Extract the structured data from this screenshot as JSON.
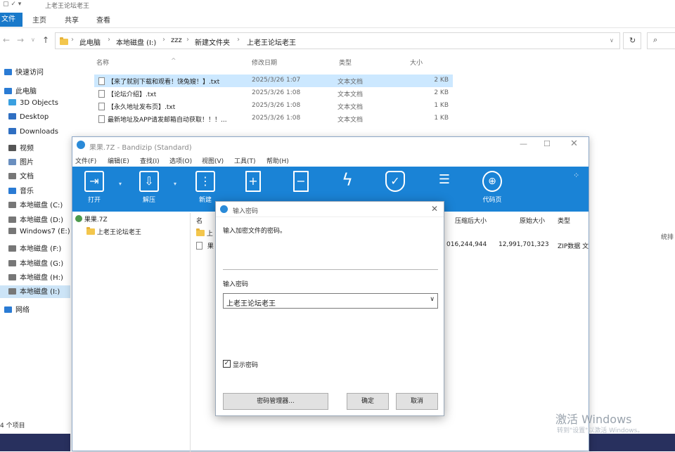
{
  "explorer": {
    "title": "上老王论坛老王",
    "ribbon_tabs": [
      "文件",
      "主页",
      "共享",
      "查看"
    ],
    "breadcrumbs": [
      "此电脑",
      "本地磁盘 (I:)",
      "zzz",
      "新建文件夹",
      "上老王论坛老王"
    ],
    "sidebar": [
      {
        "label": "快速访问",
        "icon": "star-icon",
        "color": "#2a7bd4"
      },
      {
        "label": "此电脑",
        "icon": "computer-icon",
        "color": "#2a7bd4"
      },
      {
        "label": "3D Objects",
        "icon": "cube-icon",
        "color": "#3aa0e0"
      },
      {
        "label": "Desktop",
        "icon": "desktop-icon",
        "color": "#2f6fc2"
      },
      {
        "label": "Downloads",
        "icon": "download-icon",
        "color": "#2f6fc2"
      },
      {
        "label": "视频",
        "icon": "video-icon",
        "color": "#555"
      },
      {
        "label": "图片",
        "icon": "image-icon",
        "color": "#6a8fbf"
      },
      {
        "label": "文档",
        "icon": "document-icon",
        "color": "#777"
      },
      {
        "label": "音乐",
        "icon": "music-icon",
        "color": "#2a7bd4"
      },
      {
        "label": "本地磁盘 (C:)",
        "icon": "drive-icon",
        "color": "#777"
      },
      {
        "label": "本地磁盘 (D:)",
        "icon": "drive-icon",
        "color": "#777"
      },
      {
        "label": "Windows7 (E:)",
        "icon": "drive-icon",
        "color": "#777"
      },
      {
        "label": "本地磁盘 (F:)",
        "icon": "drive-icon",
        "color": "#777"
      },
      {
        "label": "本地磁盘 (G:)",
        "icon": "drive-icon",
        "color": "#777"
      },
      {
        "label": "本地磁盘 (H:)",
        "icon": "drive-icon",
        "color": "#777"
      },
      {
        "label": "本地磁盘 (I:)",
        "icon": "drive-icon",
        "color": "#777"
      },
      {
        "label": "网络",
        "icon": "network-icon",
        "color": "#2a7bd4"
      }
    ],
    "columns": [
      "名称",
      "修改日期",
      "类型",
      "大小"
    ],
    "files": [
      {
        "name": "【来了就别下载和观看！饶兔嫂！】.txt",
        "date": "2025/3/26 1:07",
        "type": "文本文档",
        "size": "2 KB"
      },
      {
        "name": "【论坛介绍】.txt",
        "date": "2025/3/26 1:08",
        "type": "文本文档",
        "size": "2 KB"
      },
      {
        "name": "【永久地址发布页】.txt",
        "date": "2025/3/26 1:08",
        "type": "文本文档",
        "size": "1 KB"
      },
      {
        "name": "最新地址及APP请发邮箱自动获取！！！...",
        "date": "2025/3/26 1:08",
        "type": "文本文档",
        "size": "1 KB"
      }
    ],
    "status": "4 个项目"
  },
  "bandizip": {
    "title": "果果.7Z - Bandizip (Standard)",
    "menu": [
      "文件(F)",
      "编辑(E)",
      "查找(I)",
      "选项(O)",
      "视图(V)",
      "工具(T)",
      "帮助(H)"
    ],
    "toolbar": [
      {
        "label": "打开",
        "icon": "open-icon"
      },
      {
        "label": "解压",
        "icon": "extract-icon"
      },
      {
        "label": "新建",
        "icon": "new-archive-icon"
      },
      {
        "label": "",
        "icon": "add-file-icon"
      },
      {
        "label": "",
        "icon": "delete-file-icon"
      },
      {
        "label": "",
        "icon": "test-icon"
      },
      {
        "label": "",
        "icon": "shield-icon"
      },
      {
        "label": "",
        "icon": "view-icon"
      },
      {
        "label": "代码页",
        "icon": "globe-icon"
      }
    ],
    "tree": [
      "果果.7Z",
      "上老王论坛老王"
    ],
    "list_columns": [
      "名",
      "压缩后大小",
      "原始大小",
      "类型"
    ],
    "list_rows": [
      {
        "name": "上",
        "packed": "",
        "original": "",
        "type": ""
      },
      {
        "name": "果",
        "packed": "016,244,944",
        "original": "12,991,701,323",
        "type": "ZIP数据 文"
      }
    ]
  },
  "dialog": {
    "title": "输入密码",
    "prompt": "输入加密文件的密码。",
    "field_label": "输入密码",
    "password_value": "上老王论坛老王",
    "show_password_label": "显示密码",
    "show_password_checked": true,
    "buttons": {
      "manager": "密码管理器...",
      "ok": "确定",
      "cancel": "取消"
    }
  },
  "watermark": {
    "line1": "激活 Windows",
    "line2": "转到\"设置\"以激活 Windows。"
  },
  "right_edge_text": "统排"
}
